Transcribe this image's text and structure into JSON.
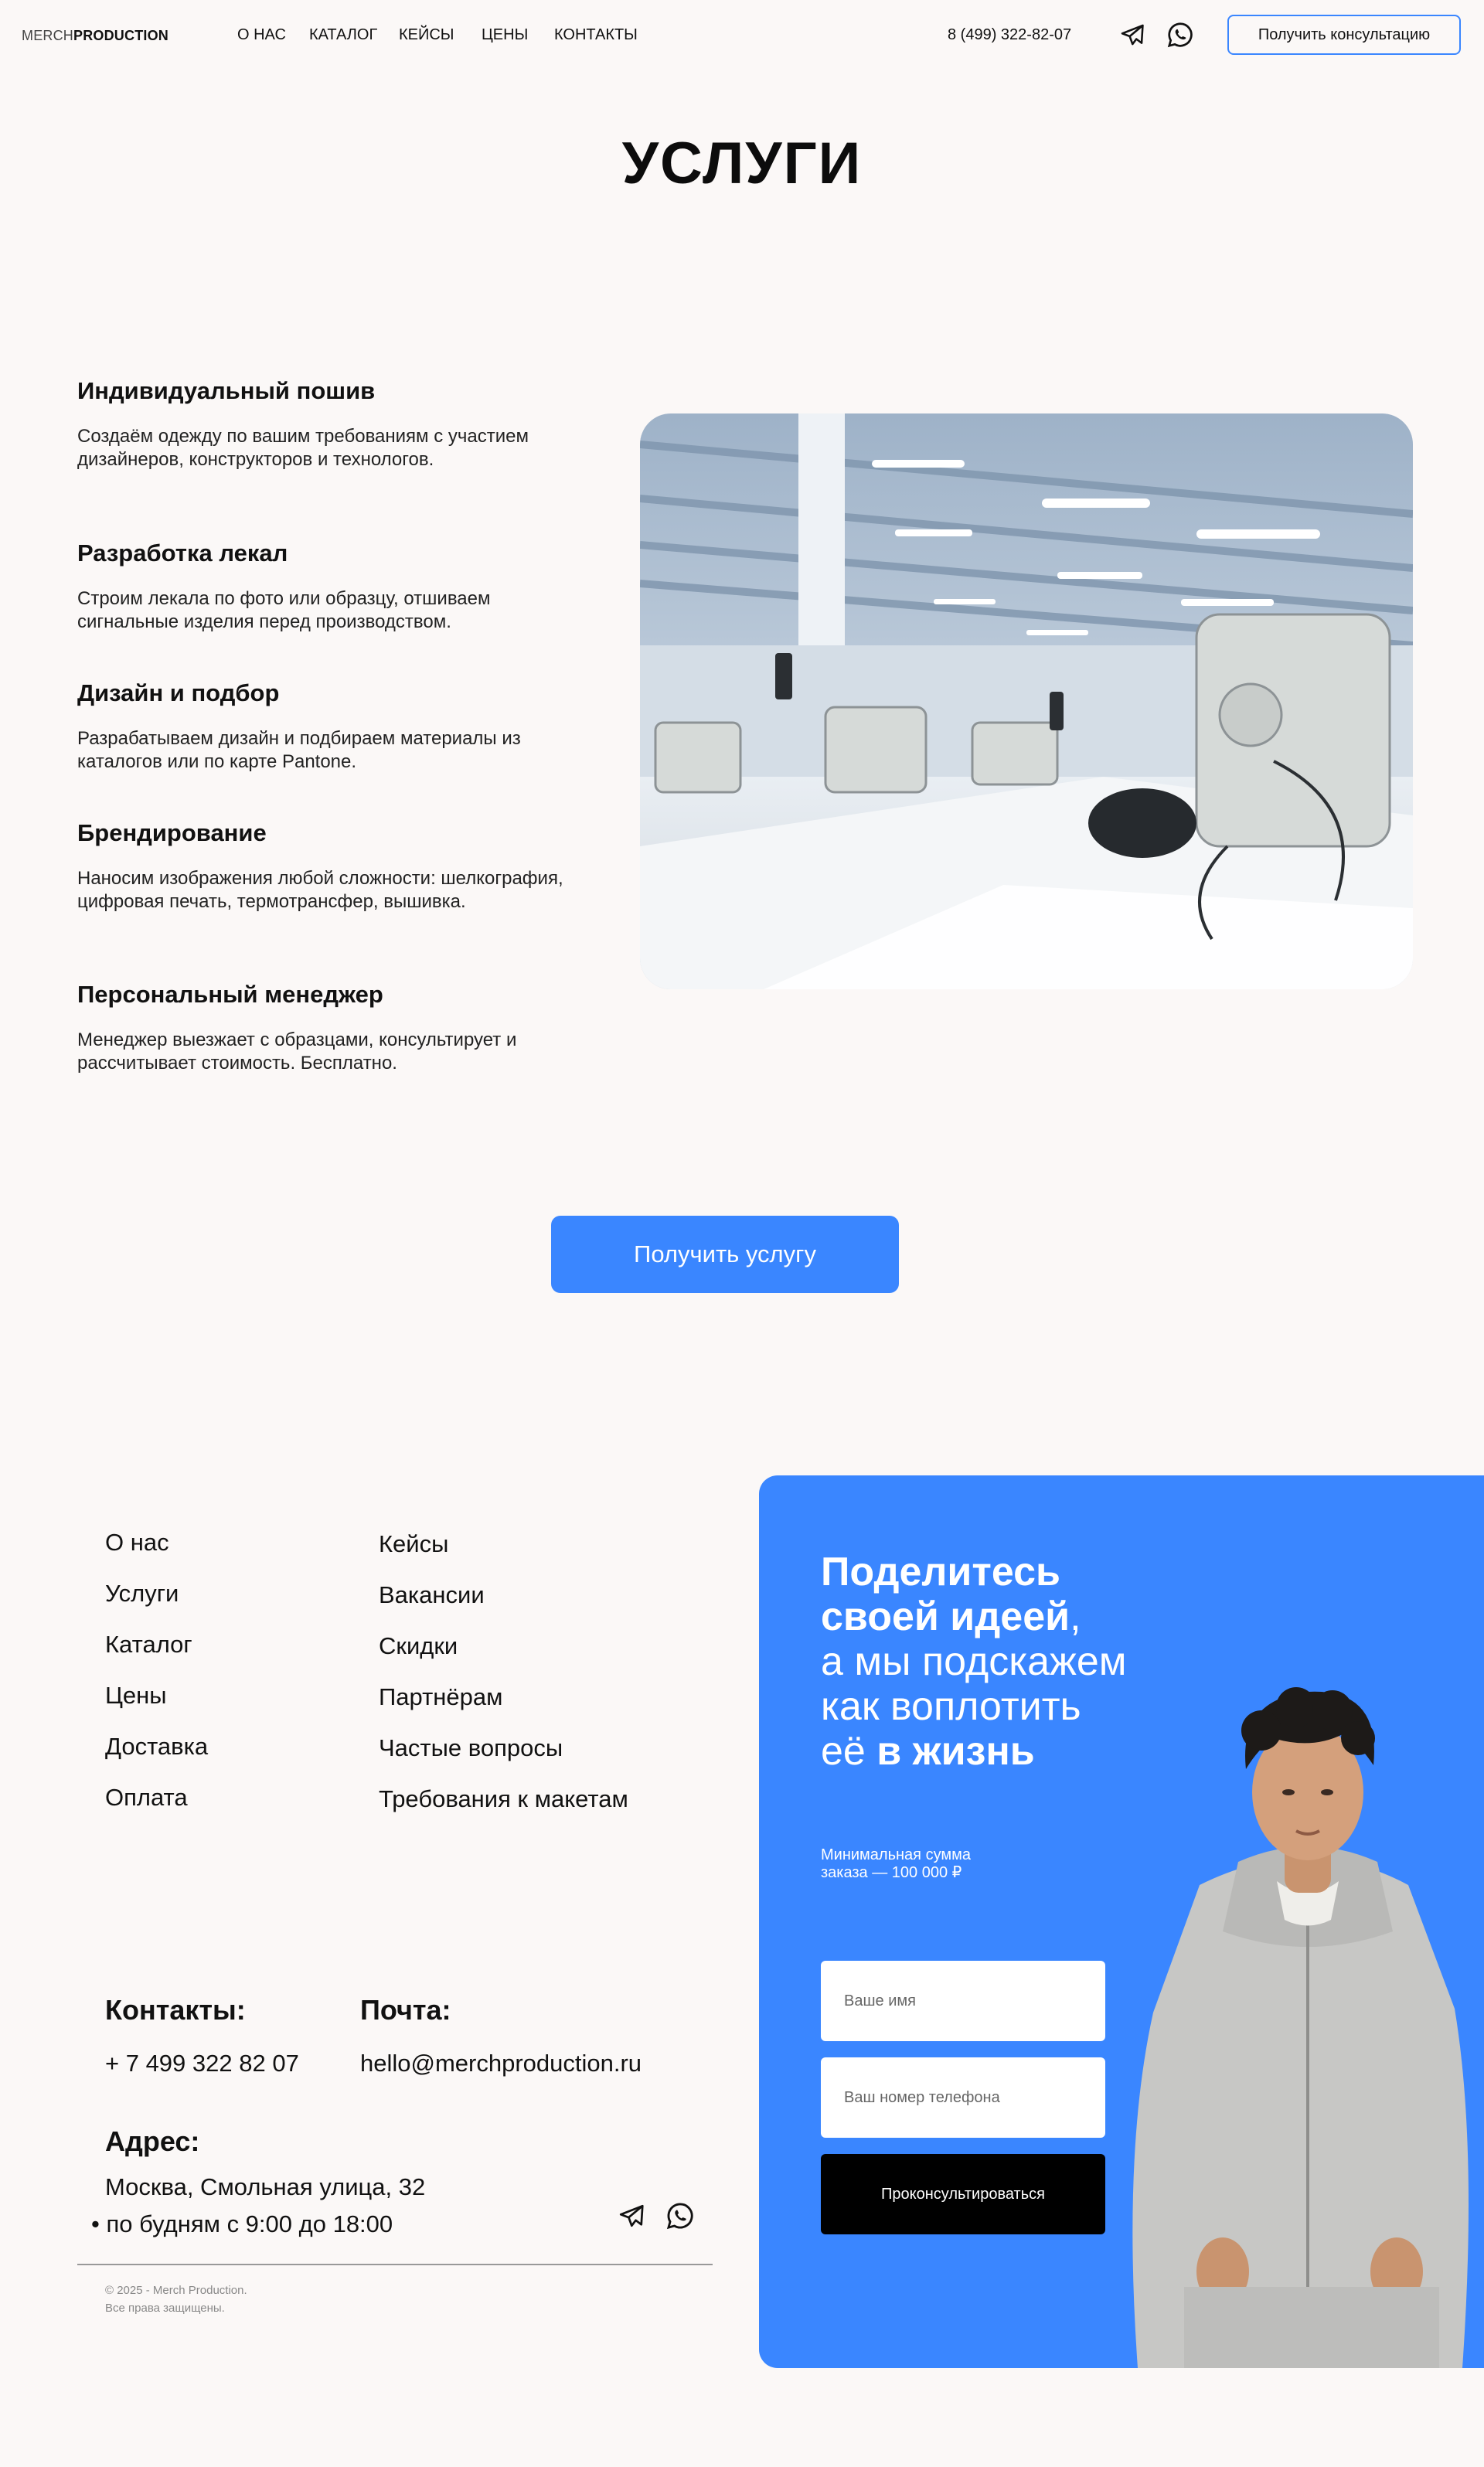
{
  "header": {
    "logo_light": "MERCH",
    "logo_bold": "PRODUCTION",
    "nav": [
      "О НАС",
      "КАТАЛОГ",
      "КЕЙСЫ",
      "ЦЕНЫ",
      "КОНТАКТЫ"
    ],
    "phone": "8 (499) 322-82-07",
    "consult_label": "Получить консультацию"
  },
  "services": {
    "title": "УСЛУГИ",
    "items": [
      {
        "title": "Индивидуальный пошив",
        "text": "Создаём одежду по вашим требованиям с участием дизайнеров, конструкторов и технологов."
      },
      {
        "title": "Разработка лекал",
        "text": "Строим лекала по фото или образцу, отшиваем сигнальные изделия перед производством."
      },
      {
        "title": "Дизайн и подбор",
        "text": "Разрабатываем дизайн и подбираем материалы из каталогов или по карте Pantone."
      },
      {
        "title": "Брендирование",
        "text": "Наносим изображения любой сложности: шелкография, цифровая печать, термотрансфер, вышивка."
      },
      {
        "title": "Персональный менеджер",
        "text": "Менеджер выезжает с образцами, консультирует и рассчитывает стоимость. Бесплатно."
      }
    ],
    "button_label": "Получить услугу"
  },
  "footer": {
    "links_col1": [
      "О нас",
      "Услуги",
      "Каталог",
      "Цены",
      "Доставка",
      "Оплата"
    ],
    "links_col2": [
      "Кейсы",
      "Вакансии",
      "Скидки",
      "Партнёрам",
      "Частые вопросы",
      "Требования к макетам"
    ],
    "contacts_title": "Контакты:",
    "contacts_phone": "+ 7 499 322 82 07",
    "mail_title": "Почта:",
    "mail_value": "hello@merchproduction.ru",
    "address_title": "Адрес:",
    "address_value": "Москва, Смольная улица, 32",
    "hours": "• по будням с 9:00 до 18:00",
    "copyright_line1": "© 2025 - Merch Production.",
    "copyright_line2": "Все права защищены."
  },
  "cta": {
    "title_bold1": "Поделитесь",
    "title_bold2": "своей идеей",
    "title_comma": ",",
    "title_light1": "а мы подскажем",
    "title_light2": "как воплотить",
    "title_light3": "её ",
    "title_bold3": "в жизнь",
    "note_line1": "Минимальная сумма",
    "note_line2": "заказа — 100 000 ₽",
    "name_placeholder": "Ваше имя",
    "phone_placeholder": "Ваш номер телефона",
    "submit_label": "Проконсультироваться"
  },
  "icons": {
    "telegram": "telegram-icon",
    "whatsapp": "whatsapp-icon"
  },
  "colors": {
    "accent": "#3a86ff",
    "background": "#fbf8f7",
    "text": "#111111",
    "submit": "#000000"
  }
}
